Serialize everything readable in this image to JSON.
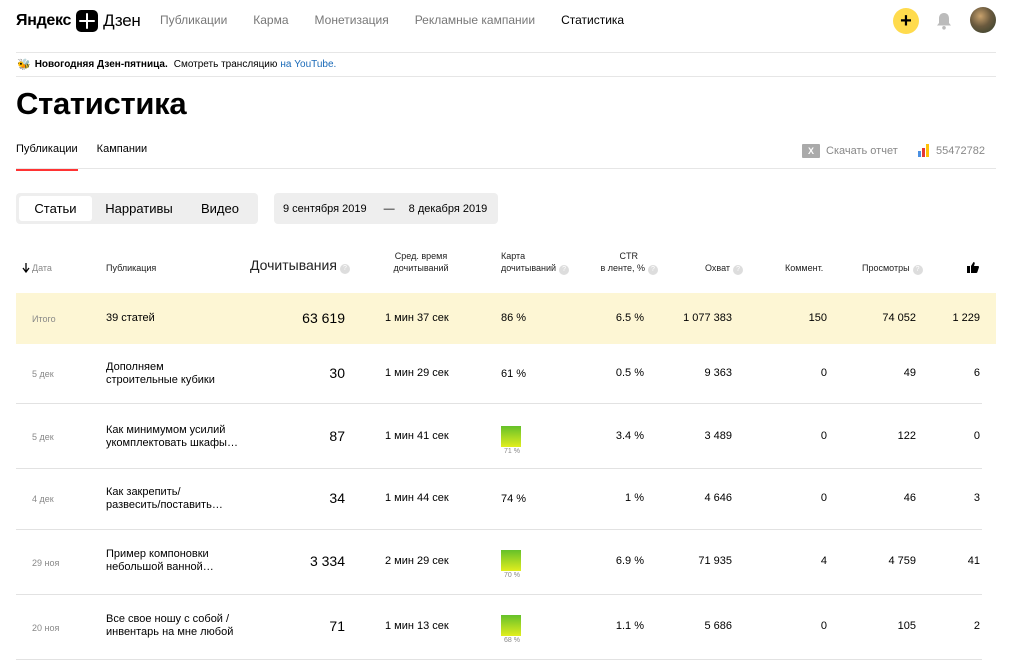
{
  "header": {
    "logo_yandex": "Яндекс",
    "logo_zen": "Дзен",
    "nav": [
      "Публикации",
      "Карма",
      "Монетизация",
      "Рекламные кампании",
      "Статистика"
    ],
    "plus_label": "+"
  },
  "promo": {
    "icon": "🐝",
    "bold": "Новогодняя Дзен-пятница.",
    "text": "Смотреть трансляцию",
    "link": "на YouTube."
  },
  "page_title": "Статистика",
  "tabs": [
    "Публикации",
    "Кампании"
  ],
  "download": {
    "icon_text": "X",
    "label": "Скачать отчет"
  },
  "counter": {
    "value": "55472782",
    "bar_colors": [
      "#4a90e2",
      "#e53935",
      "#ffc107"
    ]
  },
  "segments": [
    "Статьи",
    "Нарративы",
    "Видео"
  ],
  "daterange": {
    "from": "9 сентября 2019",
    "sep": "—",
    "to": "8 декабря 2019"
  },
  "table": {
    "columns": {
      "date": "Дата",
      "publication": "Публикация",
      "reads": "Дочитывания",
      "avg_time_1": "Сред. время",
      "avg_time_2": "дочитываний",
      "map_1": "Карта",
      "map_2": "дочитываний",
      "ctr_1": "CTR",
      "ctr_2": "в ленте, %",
      "reach": "Охват",
      "comments": "Коммент.",
      "views": "Просмотры"
    },
    "help_mark": "?",
    "total": {
      "label": "Итого",
      "publication": "39 статей",
      "reads": "63 619",
      "avg_time": "1 мин 37 сек",
      "map": "86 %",
      "ctr": "6.5 %",
      "reach": "1 077 383",
      "comments": "150",
      "views": "74 052",
      "likes": "1 229"
    },
    "rows": [
      {
        "date": "5 дек",
        "pub1": "Дополняем",
        "pub2": "строительные кубики",
        "reads": "30",
        "avg_time": "1 мин 29 сек",
        "map": "61 %",
        "ctr": "0.5 %",
        "reach": "9 363",
        "comments": "0",
        "views": "49",
        "likes": "6"
      },
      {
        "date": "5 дек",
        "pub1": "Как минимумом усилий",
        "pub2": "укомплектовать шкафы…",
        "reads": "87",
        "avg_time": "1 мин 41 сек",
        "map": "71 %",
        "ctr": "3.4 %",
        "reach": "3 489",
        "comments": "0",
        "views": "122",
        "likes": "0"
      },
      {
        "date": "4 дек",
        "pub1": "Как закрепить/",
        "pub2": "развесить/поставить…",
        "reads": "34",
        "avg_time": "1 мин 44 сек",
        "map": "74 %",
        "ctr": "1 %",
        "reach": "4 646",
        "comments": "0",
        "views": "46",
        "likes": "3"
      },
      {
        "date": "29 ноя",
        "pub1": "Пример компоновки",
        "pub2": "небольшой ванной…",
        "reads": "3 334",
        "avg_time": "2 мин 29 сек",
        "map": "70 %",
        "ctr": "6.9 %",
        "reach": "71 935",
        "comments": "4",
        "views": "4 759",
        "likes": "41"
      },
      {
        "date": "20 ноя",
        "pub1": "Все свое ношу с собой /",
        "pub2": "инвентарь на мне любой",
        "reads": "71",
        "avg_time": "1 мин 13 сек",
        "map": "68 %",
        "ctr": "1.1 %",
        "reach": "5 686",
        "comments": "0",
        "views": "105",
        "likes": "2"
      }
    ]
  }
}
